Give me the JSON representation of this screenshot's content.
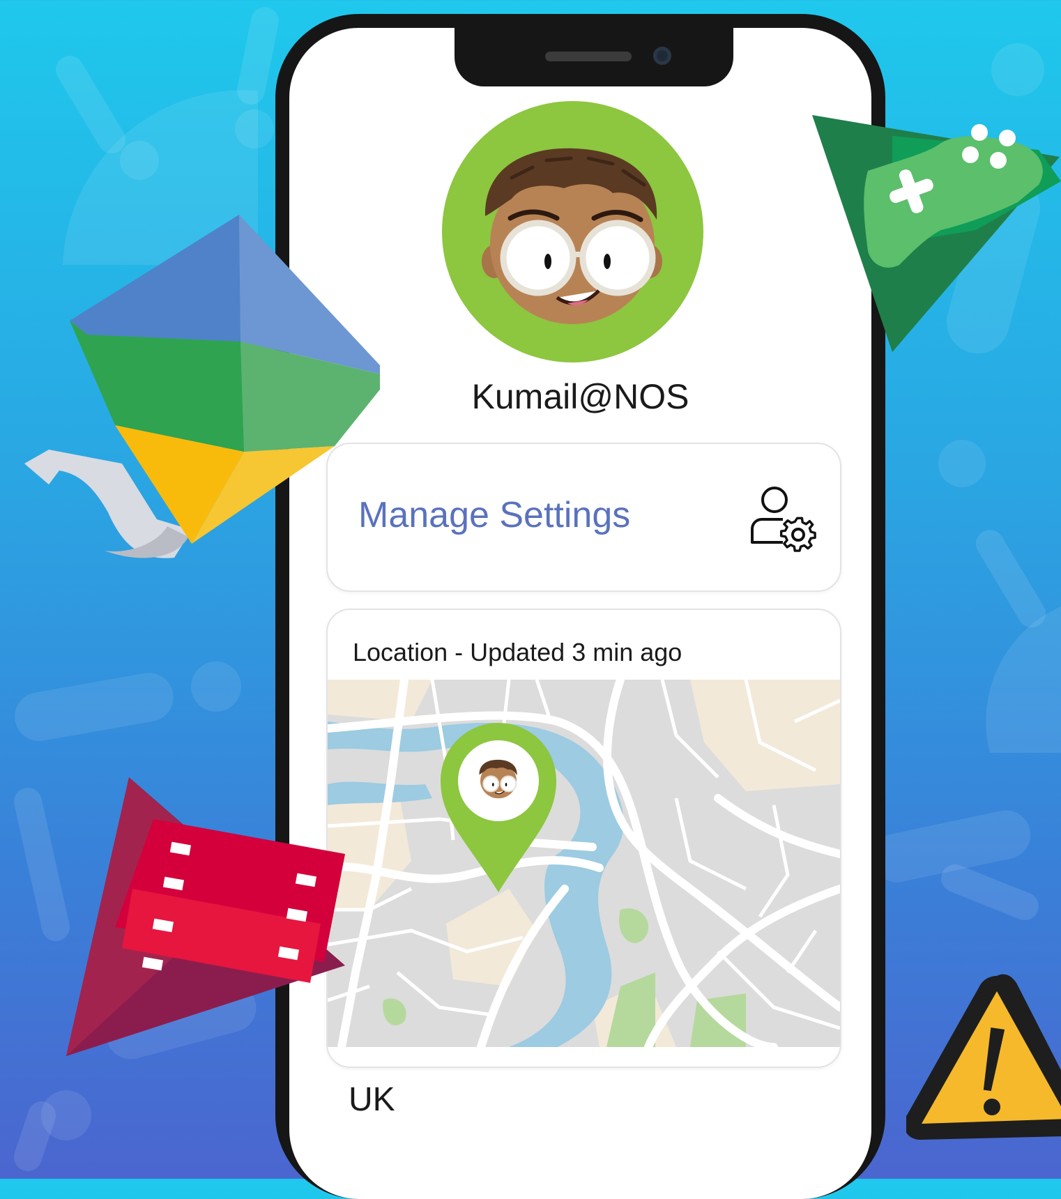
{
  "profile": {
    "username": "Kumail@NOS"
  },
  "settings_card": {
    "label": "Manage Settings",
    "icon": "user-settings-icon"
  },
  "location_card": {
    "label": "Location - Updated 3 min ago",
    "country": "UK",
    "pin_icon": "location-pin-icon"
  },
  "floating_icons": [
    "google-family-link-icon",
    "google-play-games-icon",
    "google-play-movies-icon",
    "warning-icon"
  ],
  "colors": {
    "avatar_ring": "#8dc63f",
    "settings_text": "#5a72bd",
    "pin": "#8dc63f",
    "water": "#9ccbe2",
    "park": "#b5d99c",
    "land": "#f3e9d9",
    "map_base": "#dcdcdc"
  }
}
